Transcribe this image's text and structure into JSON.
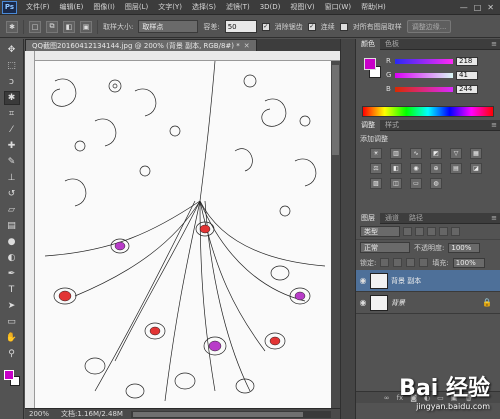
{
  "app": {
    "logo": "Ps"
  },
  "menu": [
    "文件(F)",
    "编辑(E)",
    "图像(I)",
    "图层(L)",
    "文字(Y)",
    "选择(S)",
    "滤镜(T)",
    "3D(D)",
    "视图(V)",
    "窗口(W)",
    "帮助(H)"
  ],
  "window_controls": [
    "—",
    "□",
    "✕"
  ],
  "options": {
    "sample_size_label": "取样大小:",
    "sample_size_value": "取样点",
    "tolerance_label": "容差:",
    "tolerance_value": "50",
    "antialias_label": "消除锯齿",
    "contiguous_label": "连续",
    "sample_all_label": "对所有图层取样",
    "refine_edge_label": "调整边缘..."
  },
  "document": {
    "tab_title": "QQ截图20160412134144.jpg @ 200% (背景 副本, RGB/8#) *",
    "zoom": "200%",
    "doc_info": "文档:1.16M/2.48M"
  },
  "colors": {
    "foreground": "#c800c8",
    "background": "#ffffff",
    "canvas_bg": "#fafafa",
    "selected_layer": "#4e7099"
  },
  "color_panel": {
    "tabs": [
      "颜色",
      "色板"
    ],
    "sliders": [
      {
        "label": "R",
        "value": "218"
      },
      {
        "label": "G",
        "value": "41"
      },
      {
        "label": "B",
        "value": "244"
      }
    ]
  },
  "adjust_panel": {
    "tabs": [
      "调整",
      "样式"
    ],
    "title": "添加调整"
  },
  "layers_panel": {
    "tabs": [
      "图层",
      "通道",
      "路径"
    ],
    "kind_filter": "类型",
    "blend_mode": "正常",
    "opacity_label": "不透明度:",
    "opacity_value": "100%",
    "lock_label": "锁定:",
    "fill_label": "填充:",
    "fill_value": "100%",
    "layers": [
      {
        "name": "背景 副本",
        "selected": true
      },
      {
        "name": "背景",
        "selected": false
      }
    ]
  },
  "watermark": {
    "main": "Bai 经验",
    "sub": "jingyan.baidu.com"
  }
}
